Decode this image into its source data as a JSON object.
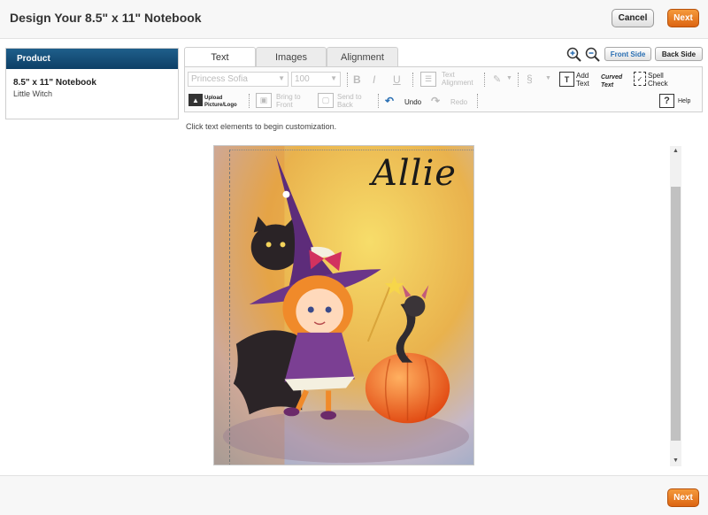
{
  "header": {
    "title": "Design Your 8.5\" x 11\" Notebook",
    "cancel_label": "Cancel",
    "next_label": "Next"
  },
  "product": {
    "header": "Product",
    "name": "8.5\" x 11\" Notebook",
    "variant": "Little Witch"
  },
  "tabs": [
    {
      "label": "Text"
    },
    {
      "label": "Images"
    },
    {
      "label": "Alignment"
    }
  ],
  "sides": {
    "front": "Front Side",
    "back": "Back Side"
  },
  "toolbar": {
    "font_value": "Princess Sofia",
    "size_value": "100",
    "bold": "B",
    "italic": "I",
    "underline": "U",
    "text_alignment": "Text Alignment",
    "add_text": "Add Text",
    "curved_text": "Curved Text",
    "spell_check": "Spell Check",
    "upload": "Upload Picture/Logo",
    "bring_front": "Bring to Front",
    "send_back": "Send to Back",
    "undo": "Undo",
    "redo": "Redo",
    "help": "Help"
  },
  "hint": "Click text elements to begin customization.",
  "design": {
    "name_text": "Allie"
  },
  "footer": {
    "next_label": "Next"
  },
  "icons": [
    "zoom-in-icon",
    "zoom-out-icon",
    "align-lines-icon",
    "fill-color-icon",
    "stroke-icon",
    "add-text-icon",
    "curved-text-icon",
    "spell-check-icon",
    "image-icon",
    "bring-to-front-icon",
    "send-to-back-icon",
    "undo-arrow-icon",
    "redo-arrow-icon",
    "question-mark-icon",
    "scroll-up-arrow-icon",
    "scroll-down-arrow-icon"
  ],
  "colors": {
    "accent": "#e87a24",
    "product_header": "#0d3f66",
    "link_blue": "#2a6fb3"
  }
}
